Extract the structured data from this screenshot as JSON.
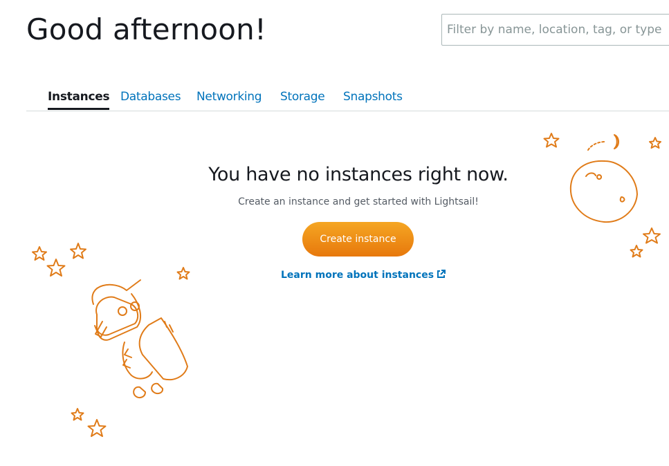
{
  "header": {
    "greeting": "Good afternoon!",
    "search_placeholder": "Filter by name, location, tag, or type"
  },
  "tabs": [
    {
      "label": "Instances",
      "active": true
    },
    {
      "label": "Databases",
      "active": false
    },
    {
      "label": "Networking",
      "active": false
    },
    {
      "label": "Storage",
      "active": false
    },
    {
      "label": "Snapshots",
      "active": false
    }
  ],
  "empty_state": {
    "title": "You have no instances right now.",
    "subtitle": "Create an instance and get started with Lightsail!",
    "create_button": "Create instance",
    "learn_more": "Learn more about instances"
  },
  "icons": {
    "external_link": "external-link-icon",
    "robot": "robot-illustration",
    "planet": "planet-illustration",
    "stars": "star-icon"
  },
  "colors": {
    "accent_orange": "#ec7211",
    "link_blue": "#0073bb",
    "text_dark": "#16191f",
    "illustration": "#e07b18"
  }
}
